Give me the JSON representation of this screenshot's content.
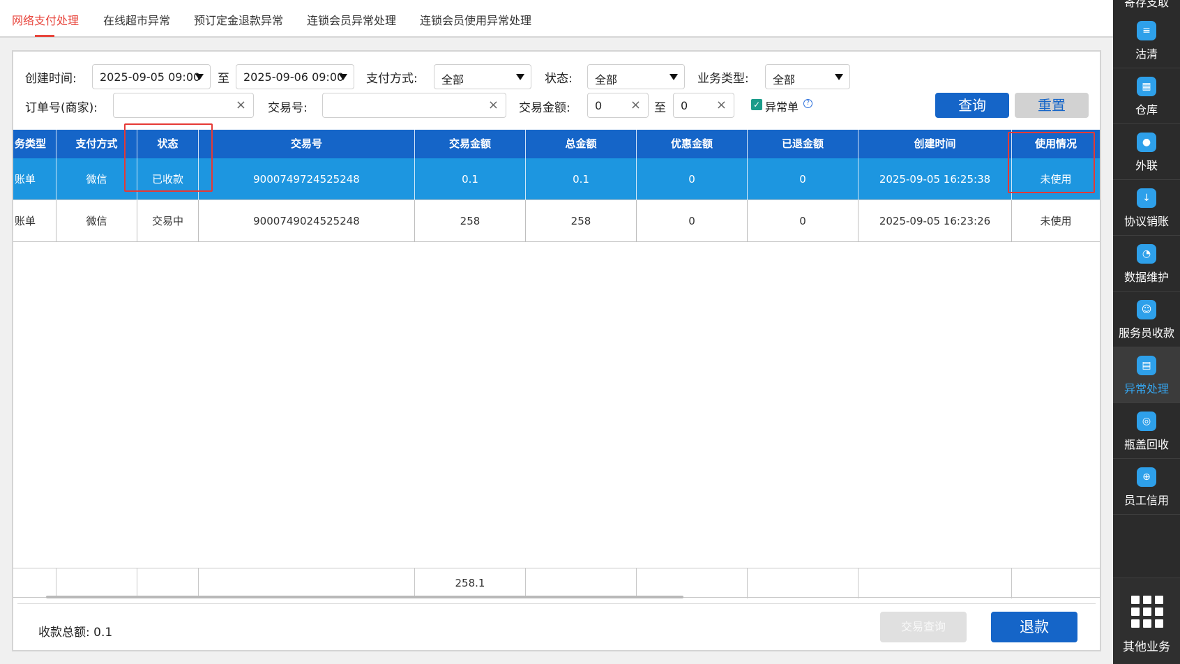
{
  "tabs": [
    {
      "label": "网络支付处理",
      "active": true
    },
    {
      "label": "在线超市异常",
      "active": false
    },
    {
      "label": "预订定金退款异常",
      "active": false
    },
    {
      "label": "连锁会员异常处理",
      "active": false
    },
    {
      "label": "连锁会员使用异常处理",
      "active": false
    }
  ],
  "filters": {
    "created_label": "创建时间:",
    "created_from": "2025-09-05 09:00",
    "to_label": "至",
    "created_to": "2025-09-06 09:00",
    "pay_method_label": "支付方式:",
    "pay_method_value": "全部",
    "status_label": "状态:",
    "status_value": "全部",
    "biz_type_label": "业务类型:",
    "biz_type_value": "全部",
    "order_no_label": "订单号(商家):",
    "order_no_value": "",
    "trade_no_label": "交易号:",
    "trade_no_value": "",
    "amount_label": "交易金额:",
    "amount_from": "0",
    "amount_to": "0",
    "abnormal_label": "异常单",
    "abnormal_checked": true,
    "clear_symbol": "×",
    "query_button": "查询",
    "reset_button": "重置"
  },
  "table": {
    "headers": [
      "务类型",
      "支付方式",
      "状态",
      "交易号",
      "交易金额",
      "总金额",
      "优惠金额",
      "已退金额",
      "创建时间",
      "使用情况"
    ],
    "rows": [
      [
        "账单",
        "微信",
        "已收款",
        "9000749724525248",
        "0.1",
        "0.1",
        "0",
        "0",
        "2025-09-05 16:25:38",
        "未使用"
      ],
      [
        "账单",
        "微信",
        "交易中",
        "9000749024525248",
        "258",
        "258",
        "0",
        "0",
        "2025-09-05 16:23:26",
        "未使用"
      ]
    ],
    "selected_row": 0,
    "summary_amount": "258.1"
  },
  "footer": {
    "total_label": "收款总额:",
    "total_value": "0.1",
    "trade_query_button": "交易查询",
    "refund_button": "退款"
  },
  "sidebar": {
    "top_partial": "寄存支取",
    "items": [
      {
        "label": "沽清",
        "icon": "list-icon",
        "active": false
      },
      {
        "label": "仓库",
        "icon": "warehouse-icon",
        "active": false
      },
      {
        "label": "外联",
        "icon": "contact-icon",
        "active": false
      },
      {
        "label": "协议销账",
        "icon": "download-icon",
        "active": false
      },
      {
        "label": "数据维护",
        "icon": "pie-chart-icon",
        "active": false
      },
      {
        "label": "服务员收款",
        "icon": "waiter-icon",
        "active": false
      },
      {
        "label": "异常处理",
        "icon": "box-icon",
        "active": true
      },
      {
        "label": "瓶盖回收",
        "icon": "recycle-icon",
        "active": false
      },
      {
        "label": "员工信用",
        "icon": "credit-icon",
        "active": false
      }
    ],
    "more_label": "其他业务"
  },
  "colors": {
    "primary": "#1565c8",
    "selected_row": "#1d96e0",
    "active_tab": "#e8453c",
    "highlight_box": "#e53935"
  }
}
